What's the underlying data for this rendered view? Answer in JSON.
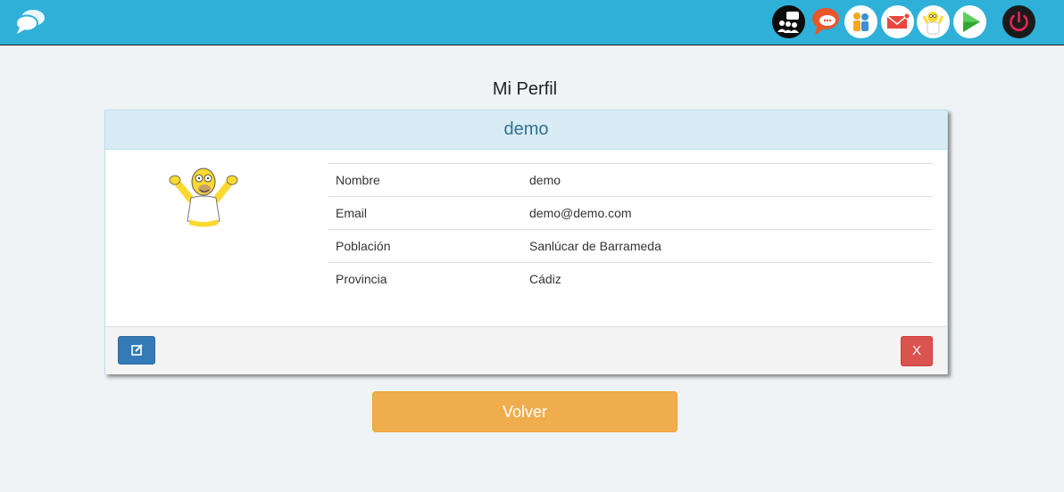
{
  "page": {
    "title": "Mi Perfil"
  },
  "topbar": {
    "background": "#2fb0d9",
    "icons": [
      "chat-bubbles-logo-icon",
      "group-chat-icon",
      "messages-icon",
      "contacts-icon",
      "mail-icon",
      "avatar-homer-icon",
      "play-icon",
      "power-icon"
    ]
  },
  "profile": {
    "username": "demo",
    "fields": [
      {
        "label": "Nombre",
        "value": "demo"
      },
      {
        "label": "Email",
        "value": "demo@demo.com"
      },
      {
        "label": "Población",
        "value": "Sanlúcar de Barrameda"
      },
      {
        "label": "Provincia",
        "value": "Cádiz"
      }
    ]
  },
  "actions": {
    "delete_label": "X",
    "back_label": "Volver"
  },
  "colors": {
    "header_accent": "#31708f",
    "edit": "#337ab7",
    "delete": "#d9534f",
    "back": "#f0ad4e"
  }
}
